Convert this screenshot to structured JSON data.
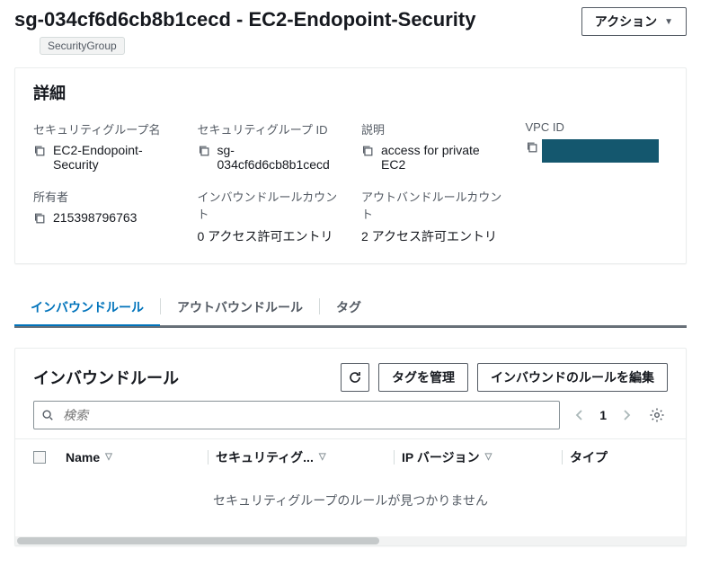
{
  "header": {
    "title": "sg-034cf6d6cb8b1cecd - EC2-Endopoint-Security",
    "tag": "SecurityGroup",
    "action_label": "アクション"
  },
  "details": {
    "panel_title": "詳細",
    "fields": {
      "name_label": "セキュリティグループ名",
      "name_value": "EC2-Endopoint-Security",
      "id_label": "セキュリティグループ ID",
      "id_value": "sg-034cf6d6cb8b1cecd",
      "desc_label": "説明",
      "desc_value": "access for private EC2",
      "vpc_label": "VPC ID",
      "owner_label": "所有者",
      "owner_value": "215398796763",
      "inbound_count_label": "インバウンドルールカウント",
      "inbound_count_value": "0 アクセス許可エントリ",
      "outbound_count_label": "アウトバンドルールカウント",
      "outbound_count_value": "2 アクセス許可エントリ"
    }
  },
  "tabs": {
    "inbound": "インバウンドルール",
    "outbound": "アウトバウンドルール",
    "tags": "タグ"
  },
  "rules": {
    "title": "インバウンドルール",
    "manage_tags": "タグを管理",
    "edit_rules": "インバウンドのルールを編集",
    "search_placeholder": "検索",
    "page_number": "1",
    "columns": {
      "name": "Name",
      "sg": "セキュリティグ...",
      "ipv": "IP バージョン",
      "type": "タイプ"
    },
    "empty_message": "セキュリティグループのルールが見つかりません"
  }
}
